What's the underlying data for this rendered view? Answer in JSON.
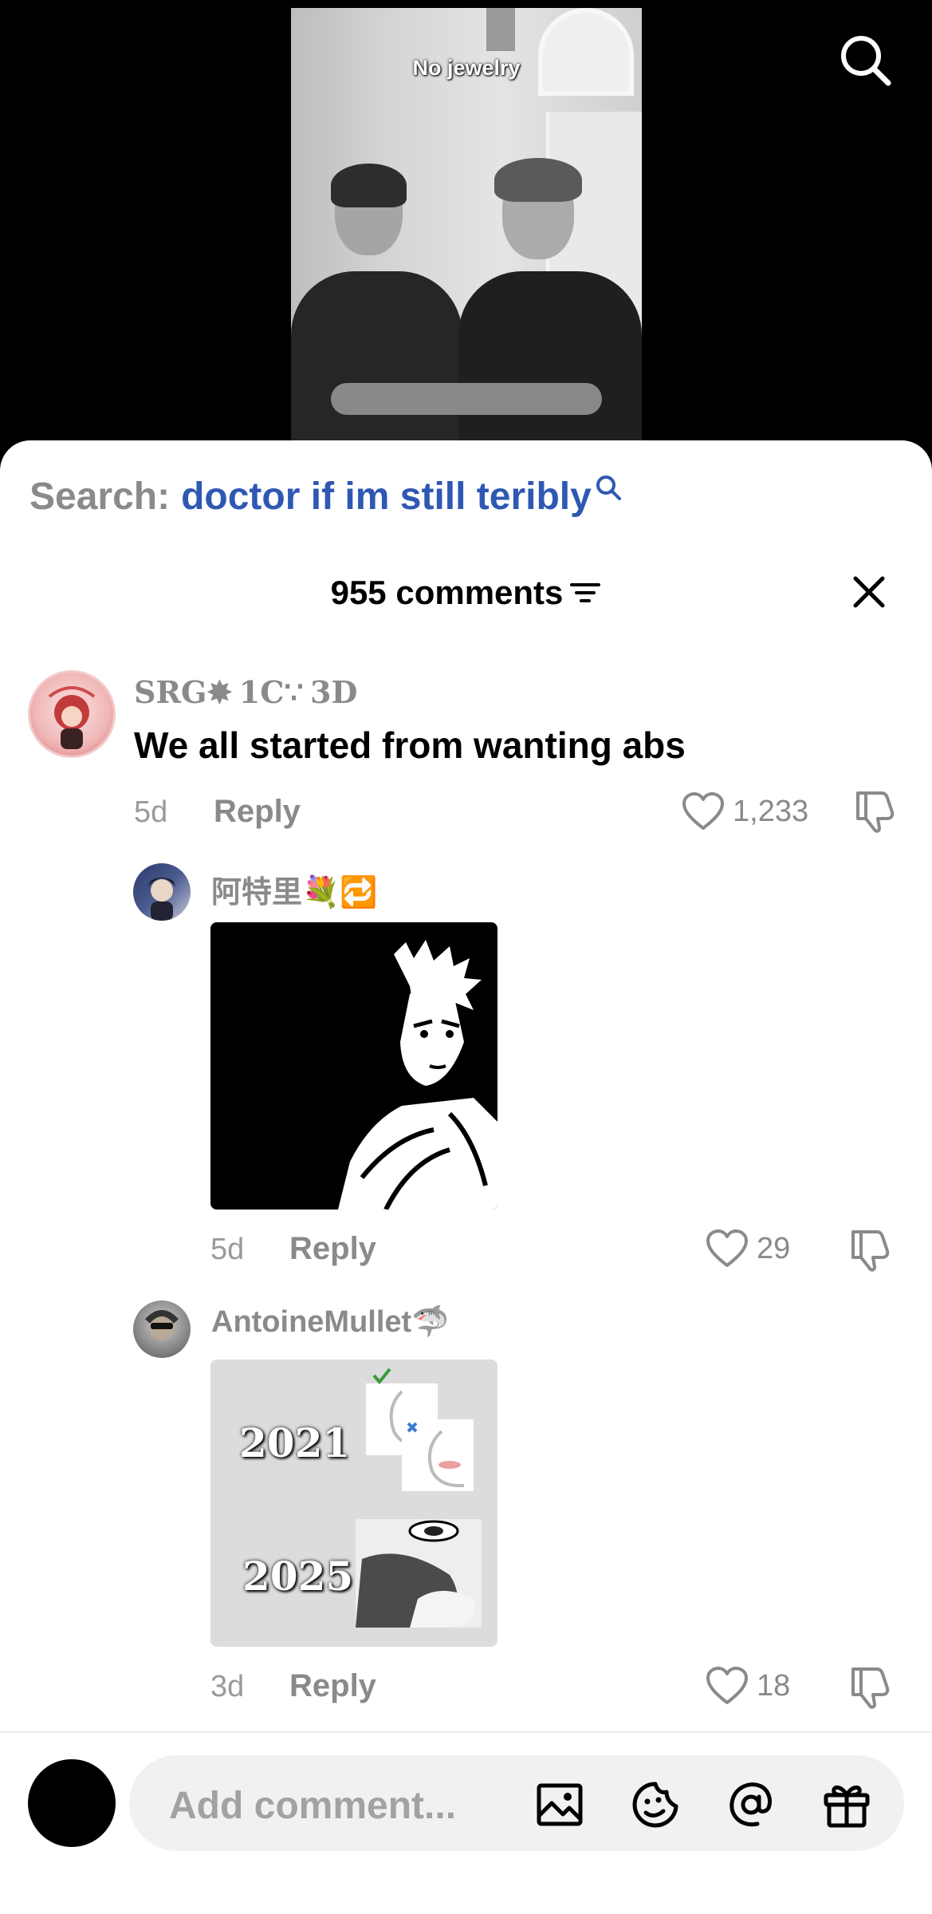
{
  "video": {
    "caption": "No jewelry"
  },
  "sheet": {
    "search_prefix": "Search:",
    "search_term": "doctor if im still teribly",
    "comment_count_label": "955 comments"
  },
  "comments": [
    {
      "username": "SRG✸ 1C∵ 3D",
      "text": "We all started from wanting abs",
      "age": "5d",
      "reply_label": "Reply",
      "likes": "1,233"
    },
    {
      "username": "阿特里💐🔁",
      "age": "5d",
      "reply_label": "Reply",
      "likes": "29"
    },
    {
      "username": "AntoineMullet🦈",
      "media_text_top": "2021",
      "media_text_bottom": "2025",
      "age": "3d",
      "reply_label": "Reply",
      "likes": "18"
    }
  ],
  "composer": {
    "placeholder": "Add comment..."
  },
  "colors": {
    "accent_blue": "#2f58b3",
    "muted_gray": "#8a8a8a",
    "pill_bg": "#f1f1f2"
  }
}
